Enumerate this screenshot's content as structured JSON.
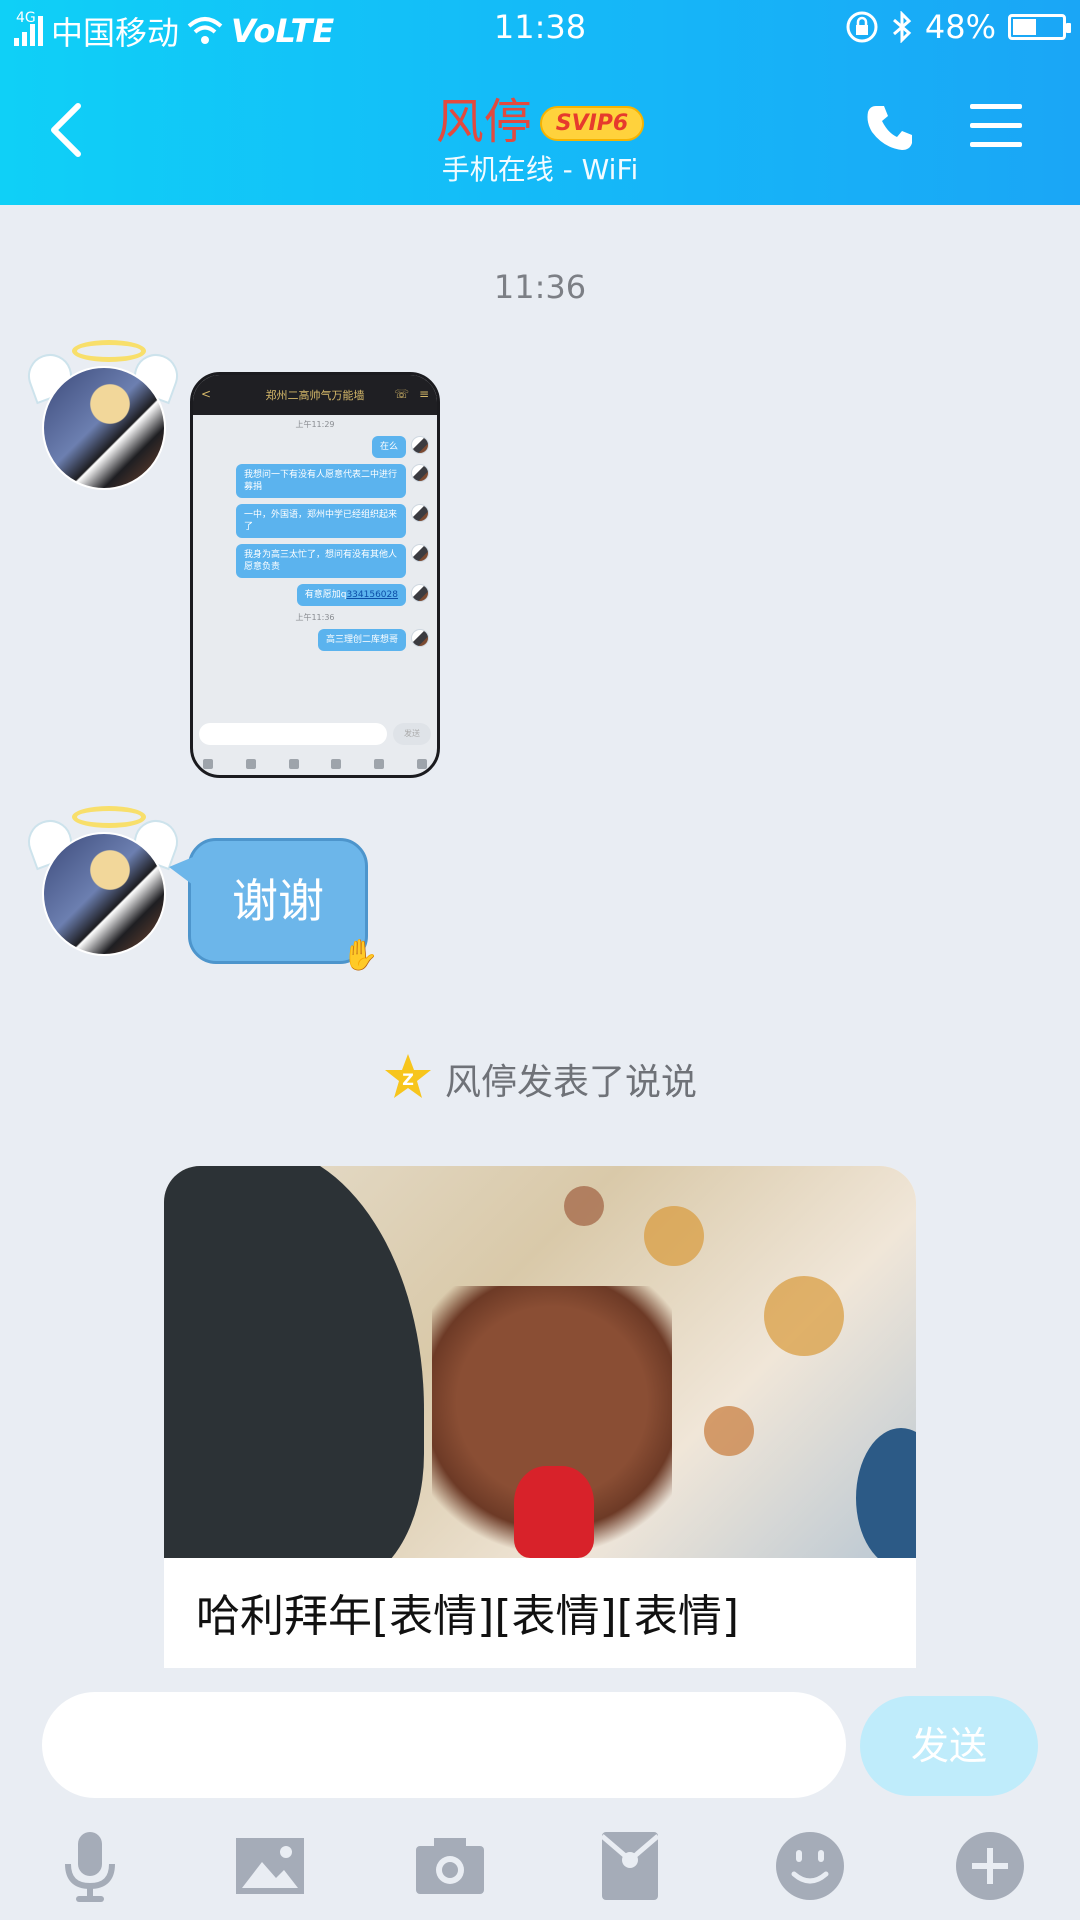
{
  "status_bar": {
    "network": "4G",
    "carrier": "中国移动",
    "volte": "VoLTE",
    "time": "11:38",
    "battery": "48%",
    "battery_level": 0.48
  },
  "header": {
    "contact_name": "风停",
    "badge": "SVIP6",
    "status": "手机在线 - WiFi"
  },
  "chat": {
    "timestamp": "11:36",
    "screenshot": {
      "title": "郑州二高帅气万能墙",
      "times": [
        "上午11:29",
        "上午11:36"
      ],
      "messages": [
        "在么",
        "我想问一下有没有人愿意代表二中进行募捐",
        "一中，外国语，郑州中学已经组织起来了",
        "我身为高三太忙了，想问有没有其他人愿意负责",
        "有意愿加q",
        "高三理创二库想哥"
      ],
      "link": "334156028",
      "send": "发送"
    },
    "reply_text": "谢谢",
    "notice": "风停发表了说说",
    "post_caption": "哈利拜年[表情][表情][表情]"
  },
  "input": {
    "placeholder": "",
    "send_label": "发送"
  },
  "toolbar": {
    "icons": [
      "microphone-icon",
      "image-icon",
      "camera-icon",
      "red-packet-icon",
      "emoji-icon",
      "plus-icon"
    ]
  },
  "colors": {
    "header_start": "#0fd0f7",
    "header_end": "#1aa6f6",
    "name_red": "#e24a3f",
    "bubble_blue": "#6cb6ea",
    "background": "#e9edf3"
  }
}
